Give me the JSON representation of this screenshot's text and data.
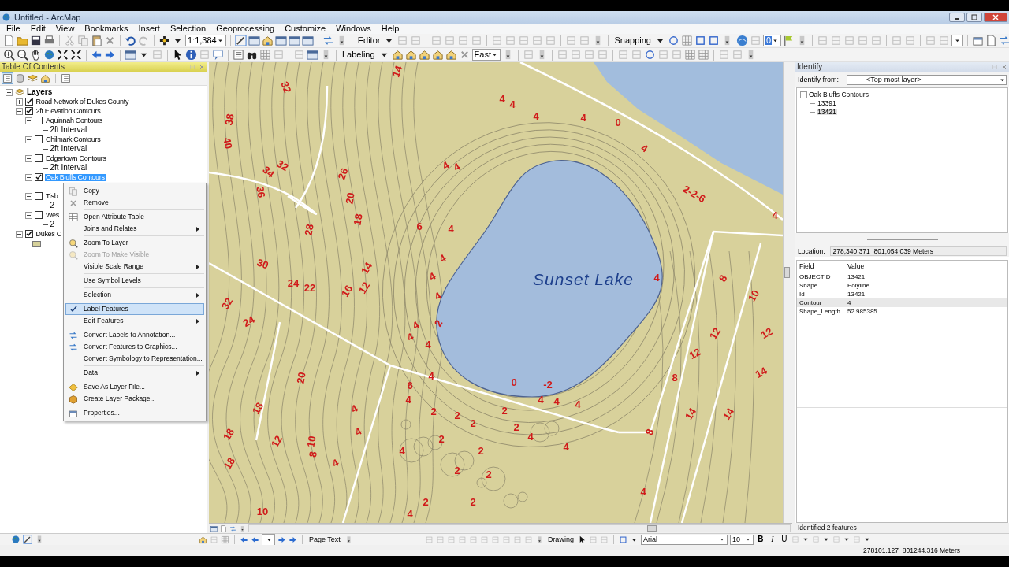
{
  "window": {
    "title": "Untitled - ArcMap"
  },
  "menu": [
    "File",
    "Edit",
    "View",
    "Bookmarks",
    "Insert",
    "Selection",
    "Geoprocessing",
    "Customize",
    "Windows",
    "Help"
  ],
  "toolbar": {
    "scale": "1:1,384",
    "editor": "Editor",
    "snapping": "Snapping",
    "labeling": "Labeling",
    "label_quality": "Fast",
    "layer_number": "0"
  },
  "toc": {
    "title": "Table Of Contents",
    "tree": [
      {
        "kind": "group",
        "label": "Layers",
        "expanded": true,
        "children": [
          {
            "kind": "layer",
            "label": "Road Network of Dukes County",
            "checked": true,
            "expanded": false,
            "selected": false
          },
          {
            "kind": "layer",
            "label": "2ft Elevation Contours",
            "checked": true,
            "expanded": true,
            "selected": false,
            "children": [
              {
                "kind": "layer",
                "label": "Aquinnah Contours",
                "checked": false,
                "expanded": true,
                "selected": false,
                "children": [
                  {
                    "kind": "legend_line",
                    "label": "2ft Interval"
                  }
                ]
              },
              {
                "kind": "layer",
                "label": "Chilmark Contours",
                "checked": false,
                "expanded": true,
                "selected": false,
                "children": [
                  {
                    "kind": "legend_line",
                    "label": "2ft Interval"
                  }
                ]
              },
              {
                "kind": "layer",
                "label": "Edgartown Contours",
                "checked": false,
                "expanded": true,
                "selected": false,
                "children": [
                  {
                    "kind": "legend_line",
                    "label": "2ft Interval"
                  }
                ]
              },
              {
                "kind": "layer",
                "label": "Oak Bluffs Contours",
                "checked": true,
                "expanded": true,
                "selected": true,
                "children": [
                  {
                    "kind": "legend_line"
                  }
                ]
              },
              {
                "kind": "layer",
                "label": "Tisb",
                "checked": false,
                "expanded": true,
                "selected": false,
                "children": [
                  {
                    "kind": "legend_line",
                    "label": "2"
                  }
                ]
              },
              {
                "kind": "layer",
                "label": "Wes",
                "checked": false,
                "expanded": true,
                "selected": false,
                "children": [
                  {
                    "kind": "legend_line",
                    "label": "2"
                  }
                ]
              }
            ]
          },
          {
            "kind": "layer",
            "label": "Dukes C",
            "checked": true,
            "expanded": true,
            "selected": false,
            "children": [
              {
                "kind": "legend_fill"
              }
            ]
          }
        ]
      }
    ]
  },
  "context_menu": [
    {
      "label": "Copy",
      "submenu": false,
      "disabled": false,
      "checked": false,
      "selected": false,
      "separator_after": false
    },
    {
      "label": "Remove",
      "submenu": false,
      "disabled": false,
      "checked": false,
      "selected": false,
      "separator_after": true
    },
    {
      "label": "Open Attribute Table",
      "submenu": false,
      "disabled": false,
      "checked": false,
      "selected": false,
      "separator_after": false
    },
    {
      "label": "Joins and Relates",
      "submenu": true,
      "disabled": false,
      "checked": false,
      "selected": false,
      "separator_after": true
    },
    {
      "label": "Zoom To Layer",
      "submenu": false,
      "disabled": false,
      "checked": false,
      "selected": false,
      "separator_after": false
    },
    {
      "label": "Zoom To Make Visible",
      "submenu": false,
      "disabled": true,
      "checked": false,
      "selected": false,
      "separator_after": false
    },
    {
      "label": "Visible Scale Range",
      "submenu": true,
      "disabled": false,
      "checked": false,
      "selected": false,
      "separator_after": true
    },
    {
      "label": "Use Symbol Levels",
      "submenu": false,
      "disabled": false,
      "checked": false,
      "selected": false,
      "separator_after": true
    },
    {
      "label": "Selection",
      "submenu": true,
      "disabled": false,
      "checked": false,
      "selected": false,
      "separator_after": true
    },
    {
      "label": "Label Features",
      "submenu": false,
      "disabled": false,
      "checked": true,
      "selected": true,
      "separator_after": false
    },
    {
      "label": "Edit Features",
      "submenu": true,
      "disabled": false,
      "checked": false,
      "selected": false,
      "separator_after": true
    },
    {
      "label": "Convert Labels to Annotation...",
      "submenu": false,
      "disabled": false,
      "checked": false,
      "selected": false,
      "separator_after": false
    },
    {
      "label": "Convert Features to Graphics...",
      "submenu": false,
      "disabled": false,
      "checked": false,
      "selected": false,
      "separator_after": false
    },
    {
      "label": "Convert Symbology to Representation...",
      "submenu": false,
      "disabled": false,
      "checked": false,
      "selected": false,
      "separator_after": true
    },
    {
      "label": "Data",
      "submenu": true,
      "disabled": false,
      "checked": false,
      "selected": false,
      "separator_after": true
    },
    {
      "label": "Save As Layer File...",
      "submenu": false,
      "disabled": false,
      "checked": false,
      "selected": false,
      "separator_after": false
    },
    {
      "label": "Create Layer Package...",
      "submenu": false,
      "disabled": false,
      "checked": false,
      "selected": false,
      "separator_after": true
    },
    {
      "label": "Properties...",
      "submenu": false,
      "disabled": false,
      "checked": false,
      "selected": false,
      "separator_after": false
    }
  ],
  "map": {
    "lake_label": "Sunset Lake",
    "contour_labels": [
      "14",
      "32",
      "38",
      "40",
      "32",
      "34",
      "36",
      "26",
      "20",
      "18",
      "28",
      "30",
      "14",
      "24",
      "22",
      "16",
      "12",
      "32",
      "24",
      "20",
      "18",
      "12",
      "18",
      "10",
      "8",
      "18",
      "10",
      "6",
      "4",
      "4",
      "4",
      "4",
      "2",
      "4",
      "4",
      "4",
      "4",
      "6",
      "4",
      "4",
      "4",
      "4",
      "4",
      "4",
      "4",
      "4",
      "4",
      "4",
      "0",
      "4",
      "2-2-6",
      "4",
      "4",
      "0",
      "-2",
      "4",
      "4",
      "4",
      "8",
      "10",
      "12",
      "12",
      "12",
      "8",
      "14",
      "14",
      "14",
      "8",
      "4",
      "4",
      "2",
      "2",
      "4",
      "2",
      "2",
      "2",
      "2",
      "2",
      "2",
      "2",
      "2",
      "2",
      "4",
      "4"
    ]
  },
  "identify": {
    "title": "Identify",
    "from_label": "Identify from:",
    "from_value": "<Top-most layer>",
    "tree": [
      {
        "label": "Oak Bluffs Contours",
        "expanded": true,
        "children": [
          {
            "label": "13391",
            "selected": false
          },
          {
            "label": "13421",
            "selected": true
          }
        ]
      }
    ],
    "location_label": "Location:",
    "location": "278,340.371  801,054.039 Meters",
    "columns": [
      "Field",
      "Value"
    ],
    "rows": [
      {
        "field": "OBJECTID",
        "value": "13421",
        "selected": false
      },
      {
        "field": "Shape",
        "value": "Polyline",
        "selected": false
      },
      {
        "field": "Id",
        "value": "13421",
        "selected": false
      },
      {
        "field": "Contour",
        "value": "4",
        "selected": true
      },
      {
        "field": "Shape_Length",
        "value": "52.985385",
        "selected": false
      }
    ],
    "status": "Identified 2 features"
  },
  "bottom_toolbar": {
    "page_text": "Page Text",
    "drawing": "Drawing",
    "font": "Arial",
    "font_size": "10",
    "bold": "B",
    "italic": "I",
    "underline": "U"
  },
  "status_bar": {
    "coordinates": "278101.127  801244.316 Meters"
  }
}
